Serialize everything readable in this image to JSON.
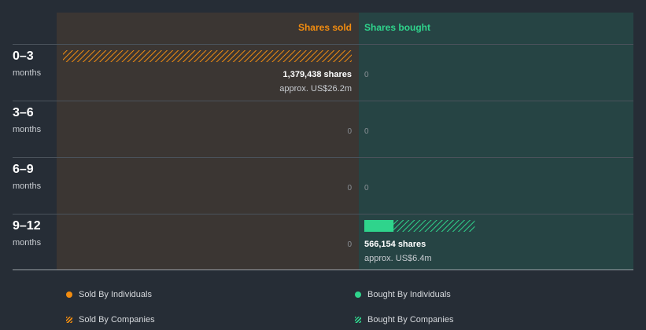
{
  "chart_data": {
    "type": "bar",
    "columns": {
      "sold": {
        "label": "Shares sold",
        "color": "#f28c0f"
      },
      "bought": {
        "label": "Shares bought",
        "color": "#2fd48c"
      }
    },
    "periods": [
      {
        "range": "0–3",
        "unit": "months",
        "sold": {
          "individuals": 0,
          "companies": 1379438,
          "label": "1,379,438 shares",
          "approx": "approx. US$26.2m",
          "zero": ""
        },
        "bought": {
          "individuals": 0,
          "companies": 0,
          "label": "",
          "approx": "",
          "zero": "0"
        }
      },
      {
        "range": "3–6",
        "unit": "months",
        "sold": {
          "individuals": 0,
          "companies": 0,
          "label": "",
          "approx": "",
          "zero": "0"
        },
        "bought": {
          "individuals": 0,
          "companies": 0,
          "label": "",
          "approx": "",
          "zero": "0"
        }
      },
      {
        "range": "6–9",
        "unit": "months",
        "sold": {
          "individuals": 0,
          "companies": 0,
          "label": "",
          "approx": "",
          "zero": "0"
        },
        "bought": {
          "individuals": 0,
          "companies": 0,
          "label": "",
          "approx": "",
          "zero": "0"
        }
      },
      {
        "range": "9–12",
        "unit": "months",
        "sold": {
          "individuals": 0,
          "companies": 0,
          "label": "",
          "approx": "",
          "zero": "0"
        },
        "bought": {
          "individuals": 150000,
          "companies": 416154,
          "label": "566,154 shares",
          "approx": "approx. US$6.4m",
          "zero": ""
        }
      }
    ],
    "max_value": 1379438
  },
  "legend": {
    "sold_individuals": "Sold By Individuals",
    "bought_individuals": "Bought By Individuals",
    "sold_companies": "Sold By Companies",
    "bought_companies": "Bought By Companies"
  }
}
